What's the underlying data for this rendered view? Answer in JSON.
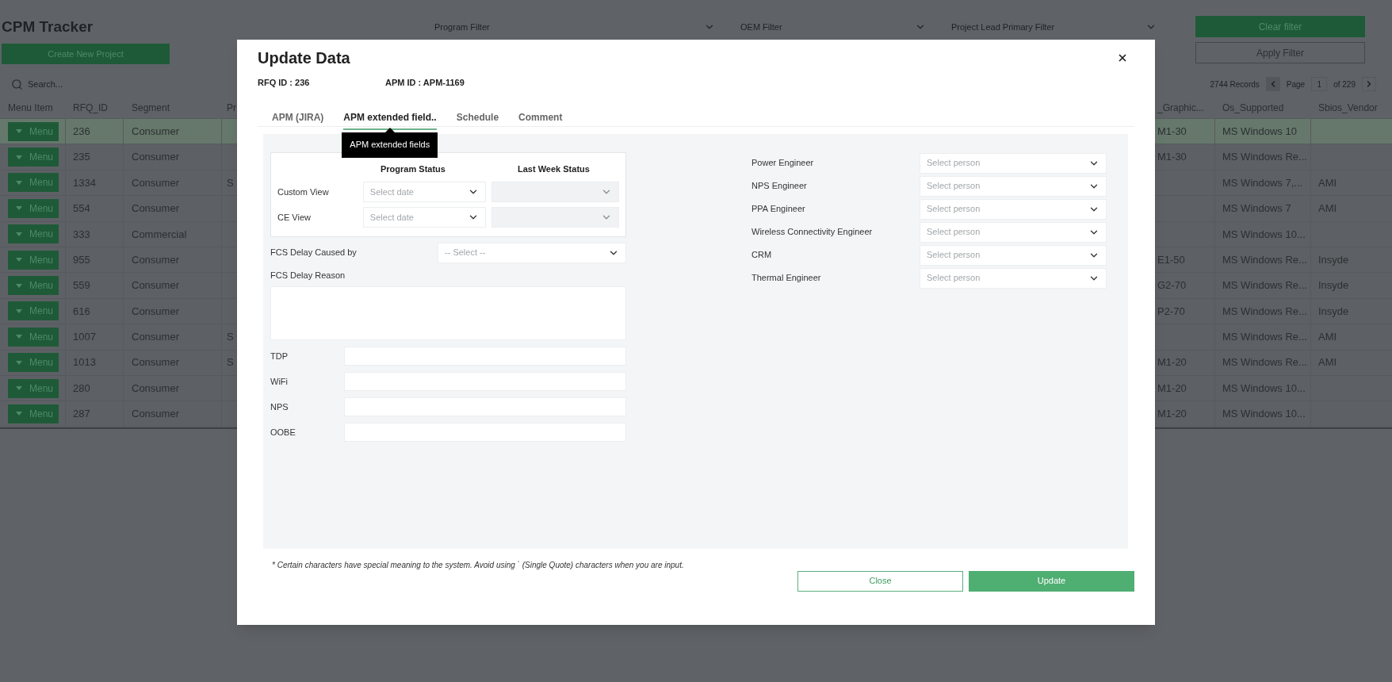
{
  "app": {
    "title": "CPM Tracker"
  },
  "filters": [
    {
      "placeholder": "Program Filter"
    },
    {
      "placeholder": "OEM Filter"
    },
    {
      "placeholder": "Project Lead Primary Filter"
    }
  ],
  "filter_buttons": {
    "clear": "Clear filter",
    "apply": "Apply Filter"
  },
  "create_button": "Create New Project",
  "search": {
    "placeholder": "Search..."
  },
  "pager": {
    "records": "2744 Records",
    "page_label": "Page",
    "page": "1",
    "of": "of 229"
  },
  "table": {
    "columns_left": [
      "Menu Item",
      "RFQ_ID",
      "Segment",
      "Pr"
    ],
    "columns_right": [
      "_Graphic...",
      "Os_Supported",
      "Sbios_Vendor"
    ],
    "rows": [
      {
        "menu": "Menu",
        "rfq_id": "236",
        "segment": "Consumer",
        "graphic": "M1-30",
        "os": "MS Windows 10",
        "selected": true
      },
      {
        "menu": "Menu",
        "rfq_id": "235",
        "segment": "Consumer",
        "graphic": "M1-30",
        "os": "MS Windows Re...",
        "selected": false
      },
      {
        "menu": "Menu",
        "rfq_id": "1334",
        "segment": "Consumer",
        "col_4": "S",
        "os": "MS Windows 7,...",
        "sbios": "AMI",
        "selected": false
      },
      {
        "menu": "Menu",
        "rfq_id": "554",
        "segment": "Consumer",
        "os": "MS Windows 7",
        "sbios": "AMI",
        "selected": false
      },
      {
        "menu": "Menu",
        "rfq_id": "333",
        "segment": "Commercial",
        "os": "MS Windows 10...",
        "selected": false
      },
      {
        "menu": "Menu",
        "rfq_id": "955",
        "segment": "Consumer",
        "graphic": "E1-50",
        "os": "MS Windows Re...",
        "sbios": "Insyde",
        "selected": false
      },
      {
        "menu": "Menu",
        "rfq_id": "559",
        "segment": "Consumer",
        "graphic": "G2-70",
        "os": "MS Windows Re...",
        "sbios": "Insyde",
        "selected": false
      },
      {
        "menu": "Menu",
        "rfq_id": "616",
        "segment": "Consumer",
        "graphic": "P2-70",
        "os": "MS Windows Re...",
        "sbios": "Insyde",
        "selected": false
      },
      {
        "menu": "Menu",
        "rfq_id": "1007",
        "segment": "Consumer",
        "col_4": "S",
        "os": "MS Windows Re...",
        "sbios": "AMI",
        "selected": false
      },
      {
        "menu": "Menu",
        "rfq_id": "1013",
        "segment": "Consumer",
        "col_4": "S",
        "graphic": "M1-20",
        "os": "MS Windows Re...",
        "sbios": "AMI",
        "selected": false
      },
      {
        "menu": "Menu",
        "rfq_id": "280",
        "segment": "Consumer",
        "graphic": "M1-20",
        "os": "MS Windows 10...",
        "selected": false
      },
      {
        "menu": "Menu",
        "rfq_id": "287",
        "segment": "Consumer",
        "graphic": "M1-20",
        "os": "MS Windows 10...",
        "selected": false
      }
    ]
  },
  "dialog": {
    "title": "Update Data",
    "rfq": "RFQ ID : 236",
    "apm": "APM ID : APM-1169",
    "tabs": [
      {
        "label": "APM (JIRA)",
        "selected": false
      },
      {
        "label": "APM extended field..",
        "selected": true,
        "tooltip": "APM extended fields"
      },
      {
        "label": "Schedule",
        "selected": false
      },
      {
        "label": "Comment",
        "selected": false
      }
    ],
    "status_table": {
      "columns": [
        "Program Status",
        "Last Week Status"
      ],
      "rows": [
        {
          "label": "Custom View",
          "program_placeholder": "Select date",
          "last_week_disabled": true
        },
        {
          "label": "CE View",
          "program_placeholder": "Select date",
          "last_week_disabled": true
        }
      ]
    },
    "fcs_delay_caused_by": {
      "label": "FCS Delay Caused by",
      "placeholder": "-- Select --"
    },
    "fcs_delay_reason": {
      "label": "FCS Delay Reason"
    },
    "text_fields": [
      {
        "label": "TDP"
      },
      {
        "label": "WiFi"
      },
      {
        "label": "NPS"
      },
      {
        "label": "OOBE"
      }
    ],
    "engineers": [
      {
        "label": "Power Engineer",
        "placeholder": "Select person"
      },
      {
        "label": "NPS Engineer",
        "placeholder": "Select person"
      },
      {
        "label": "PPA Engineer",
        "placeholder": "Select person"
      },
      {
        "label": "Wireless Connectivity Engineer",
        "placeholder": "Select person"
      },
      {
        "label": "CRM",
        "placeholder": "Select person"
      },
      {
        "label": "Thermal Engineer",
        "placeholder": "Select person"
      }
    ],
    "note": "* Certain characters have special meaning to the system. Avoid using ` (Single Quote) characters when you are input.",
    "actions": [
      {
        "label": "Close",
        "kind": "secondary"
      },
      {
        "label": "Update",
        "kind": "primary"
      }
    ]
  }
}
